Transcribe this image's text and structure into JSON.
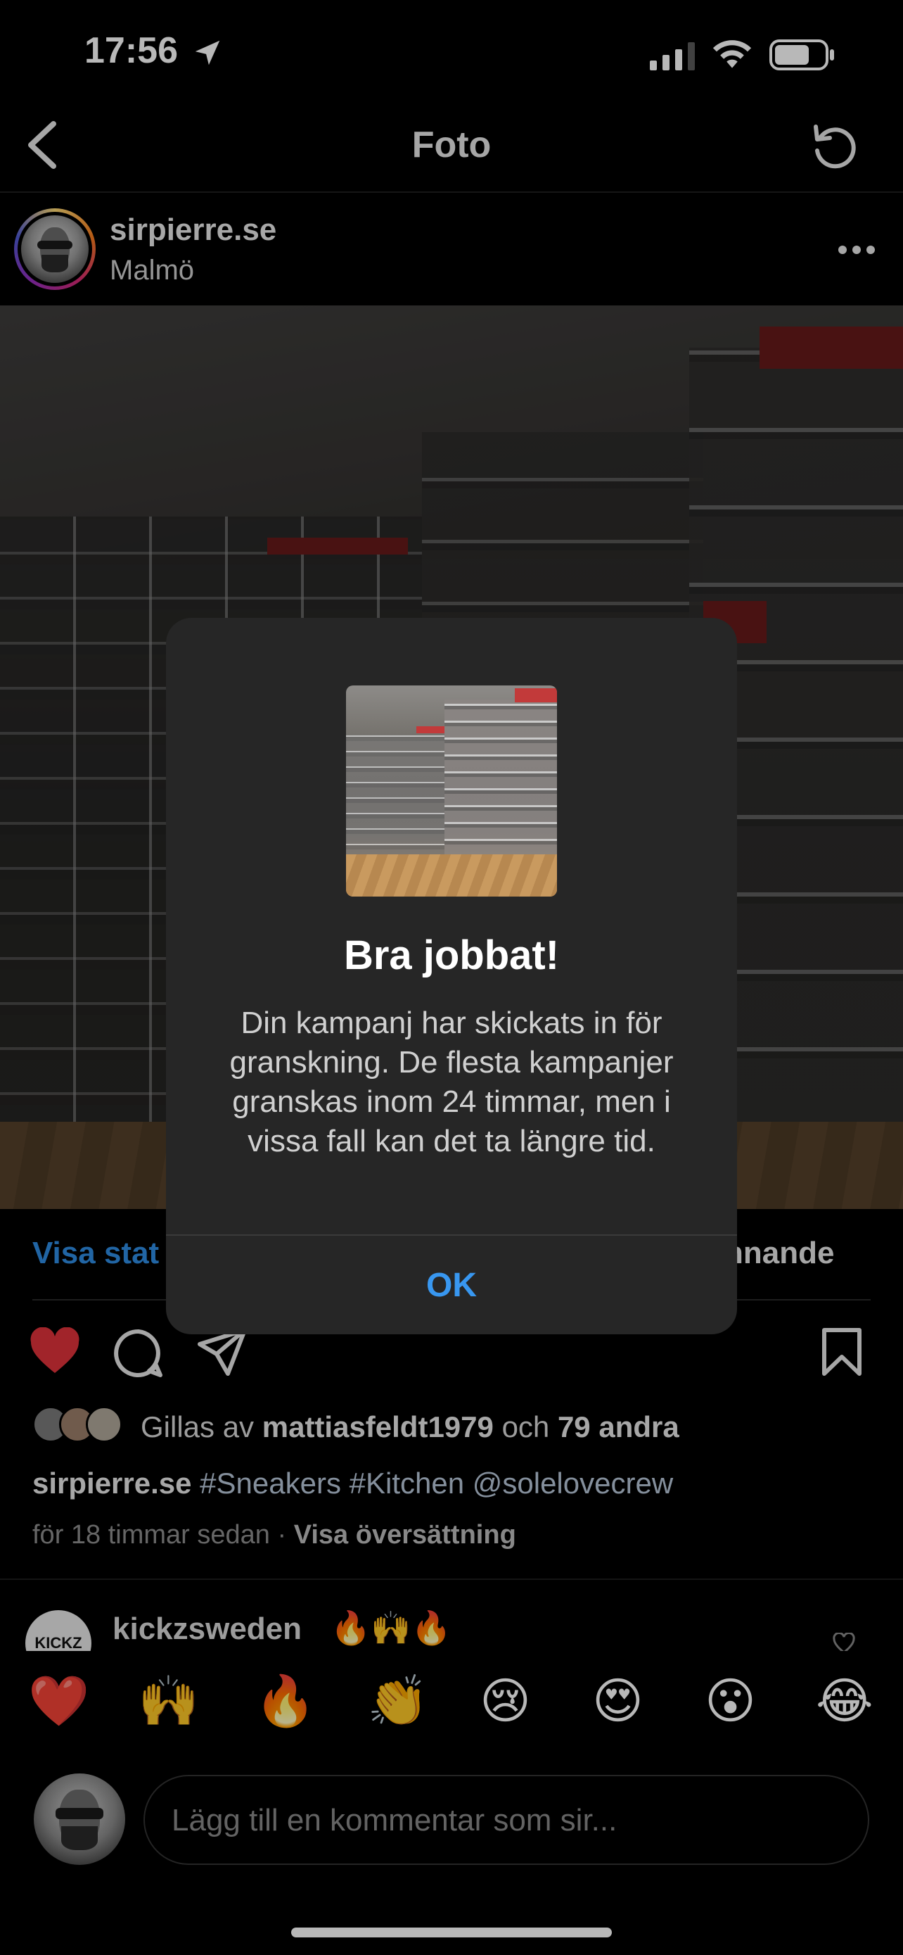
{
  "status_bar": {
    "time": "17:56"
  },
  "nav": {
    "title": "Foto"
  },
  "post": {
    "username": "sirpierre.se",
    "location": "Malmö",
    "visa_statistik_partial": "Visa stat",
    "kommande_partial": "nnande",
    "liked_by_prefix": "Gillas av",
    "liked_by_user": "mattiasfeldt1979",
    "liked_by_and": "och",
    "liked_by_others": "79 andra",
    "caption_user": "sirpierre.se",
    "caption_text": "#Sneakers #Kitchen @solelovecrew",
    "timestamp": "för 18 timmar sedan",
    "separator": "·",
    "translate_link": "Visa översättning"
  },
  "comment": {
    "avatar_text": "KICKZ",
    "username": "kickzsweden",
    "text": "🔥🙌🔥"
  },
  "emoji_bar": [
    "❤️",
    "🙌",
    "🔥",
    "👏",
    "😢",
    "😍",
    "😮",
    "😂"
  ],
  "comment_input": {
    "placeholder": "Lägg till en kommentar som sir..."
  },
  "modal": {
    "title": "Bra jobbat!",
    "body": "Din kampanj har skickats in för granskning. De flesta kampanjer granskas inom 24 timmar, men i vissa fall kan det ta längre tid.",
    "ok_label": "OK"
  },
  "colors": {
    "background": "#000000",
    "modal_bg": "#262626",
    "link_blue": "#3897f0",
    "heart_red": "#e0323b"
  }
}
